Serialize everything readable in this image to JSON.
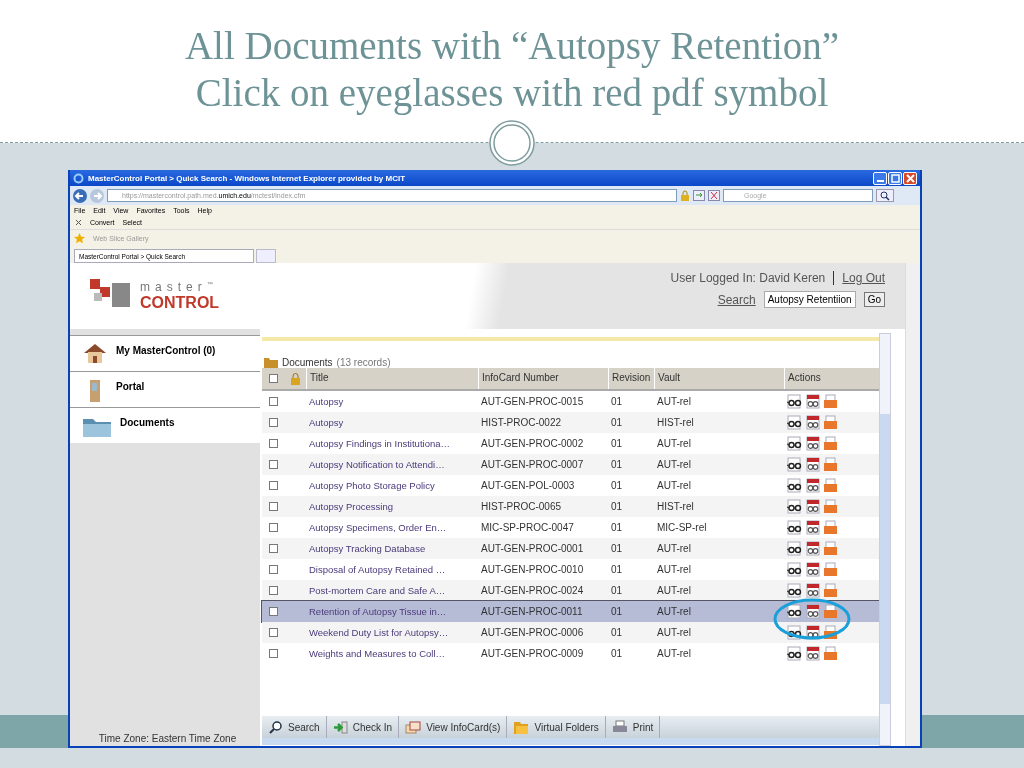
{
  "slide": {
    "title_lines": [
      "All Documents with “Autopsy Retention”",
      "Click on eyeglasses with red pdf symbol"
    ]
  },
  "browser": {
    "title": "MasterControl Portal > Quick Search - Windows Internet Explorer provided by MCIT",
    "url_prefix": "https://mastercontrol.path.med.",
    "url_host": "umich.edu",
    "url_path": "/mctest/index.cfm",
    "search_placeholder": "Google",
    "menus": [
      "File",
      "Edit",
      "View",
      "Favorites",
      "Tools",
      "Help"
    ],
    "command_items": [
      "Convert",
      "Select"
    ],
    "favorites": [
      "Web Slice Gallery"
    ],
    "tab": "MasterControl Portal > Quick Search"
  },
  "page": {
    "logo_top": "master",
    "logo_tm": "™",
    "logo_bottom": "CONTROL",
    "user_label": "User Logged In: David Keren",
    "logout": "Log Out",
    "search_link": "Search",
    "search_value": "Autopsy Retentiion",
    "go": "Go",
    "sidebar": [
      {
        "label": "My MasterControl (0)",
        "kind": "home"
      },
      {
        "label": "Portal",
        "kind": "portal"
      },
      {
        "label": "Documents",
        "kind": "folder"
      }
    ],
    "time_zone": "Time Zone: Eastern Time Zone",
    "select_all_checked": false,
    "documents_label": "Documents",
    "documents_count": "(13 records)",
    "columns": [
      "Title",
      "InfoCard Number",
      "Revision",
      "Vault",
      "Actions"
    ],
    "rows": [
      {
        "title": "Autopsy",
        "number": "AUT-GEN-PROC-0015",
        "revision": "01",
        "vault": "AUT-rel",
        "checked": false,
        "selected": false
      },
      {
        "title": "Autopsy",
        "number": "HIST-PROC-0022",
        "revision": "01",
        "vault": "HIST-rel",
        "checked": false,
        "selected": false
      },
      {
        "title": "Autopsy Findings in Institutiona…",
        "number": "AUT-GEN-PROC-0002",
        "revision": "01",
        "vault": "AUT-rel",
        "checked": false,
        "selected": false
      },
      {
        "title": "Autopsy Notification to Attendi…",
        "number": "AUT-GEN-PROC-0007",
        "revision": "01",
        "vault": "AUT-rel",
        "checked": false,
        "selected": false
      },
      {
        "title": "Autopsy Photo Storage Policy",
        "number": "AUT-GEN-POL-0003",
        "revision": "01",
        "vault": "AUT-rel",
        "checked": false,
        "selected": false
      },
      {
        "title": "Autopsy Processing",
        "number": "HIST-PROC-0065",
        "revision": "01",
        "vault": "HIST-rel",
        "checked": false,
        "selected": false
      },
      {
        "title": "Autopsy Specimens, Order En…",
        "number": "MIC-SP-PROC-0047",
        "revision": "01",
        "vault": "MIC-SP-rel",
        "checked": false,
        "selected": false
      },
      {
        "title": "Autopsy Tracking Database",
        "number": "AUT-GEN-PROC-0001",
        "revision": "01",
        "vault": "AUT-rel",
        "checked": false,
        "selected": false
      },
      {
        "title": "Disposal of Autopsy Retained …",
        "number": "AUT-GEN-PROC-0010",
        "revision": "01",
        "vault": "AUT-rel",
        "checked": false,
        "selected": false
      },
      {
        "title": "Post-mortem Care and Safe A…",
        "number": "AUT-GEN-PROC-0024",
        "revision": "01",
        "vault": "AUT-rel",
        "checked": false,
        "selected": false
      },
      {
        "title": "Retention of Autopsy Tissue in…",
        "number": "AUT-GEN-PROC-0011",
        "revision": "01",
        "vault": "AUT-rel",
        "checked": false,
        "selected": true
      },
      {
        "title": "Weekend Duty List for Autopsy…",
        "number": "AUT-GEN-PROC-0006",
        "revision": "01",
        "vault": "AUT-rel",
        "checked": false,
        "selected": false
      },
      {
        "title": "Weights and Measures to Coll…",
        "number": "AUT-GEN-PROC-0009",
        "revision": "01",
        "vault": "AUT-rel",
        "checked": false,
        "selected": false
      }
    ],
    "toolbar": [
      {
        "label": "Search",
        "kind": "search"
      },
      {
        "label": "Check In",
        "kind": "checkin"
      },
      {
        "label": "View InfoCard(s)",
        "kind": "view"
      },
      {
        "label": "Virtual Folders",
        "kind": "folders"
      },
      {
        "label": "Print",
        "kind": "print"
      }
    ]
  }
}
